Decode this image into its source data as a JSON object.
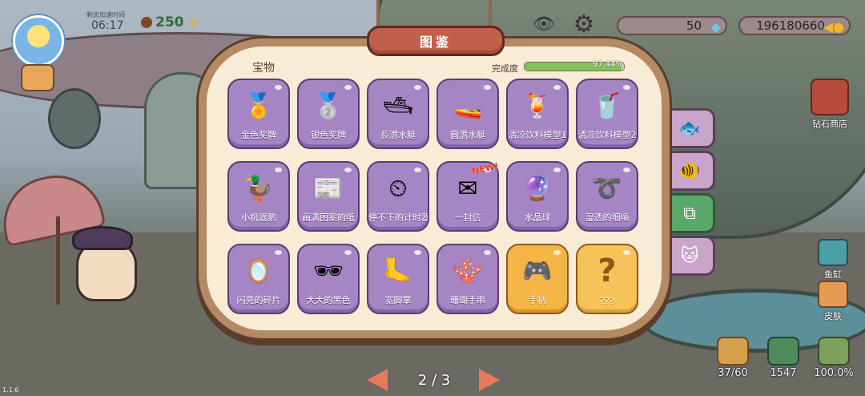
{
  "hud": {
    "time_label": "剩余加速时间",
    "time": "06:17",
    "coins": "250",
    "coins_plus": "+",
    "gems": "50",
    "fish_currency": "196180660",
    "version": "1.1.6"
  },
  "panel": {
    "title": "图鉴",
    "section": "宝物",
    "completion_label": "完成度",
    "completion_text": "97.44%",
    "completion_value": 97.44,
    "new_badge": "NEW!",
    "items": [
      {
        "name": "金色奖牌",
        "icon": "gold-medal-icon",
        "style": "purple",
        "glyph": "🏅"
      },
      {
        "name": "银色奖牌",
        "icon": "silver-medal-icon",
        "style": "purple",
        "glyph": "🥈"
      },
      {
        "name": "長潛水艇",
        "icon": "long-submarine-icon",
        "style": "purple",
        "glyph": "🛥"
      },
      {
        "name": "圓潛水艇",
        "icon": "round-submarine-icon",
        "style": "purple",
        "glyph": "🚤"
      },
      {
        "name": "清凉饮料模型1",
        "icon": "drink-model-1-icon",
        "style": "purple",
        "glyph": "🍹"
      },
      {
        "name": "清凉饮料模型2",
        "icon": "drink-model-2-icon",
        "style": "purple",
        "glyph": "🥤"
      },
      {
        "name": "小机器鹅",
        "icon": "robot-goose-icon",
        "style": "purple",
        "glyph": "🦆"
      },
      {
        "name": "画满图案的纸",
        "icon": "patterned-paper-icon",
        "style": "purple",
        "glyph": "📰"
      },
      {
        "name": "停不下的计时器",
        "icon": "timer-icon",
        "style": "purple",
        "glyph": "⏲"
      },
      {
        "name": "一封信",
        "icon": "letter-icon",
        "style": "purple",
        "glyph": "✉"
      },
      {
        "name": "水晶球",
        "icon": "crystal-ball-icon",
        "style": "purple",
        "glyph": "🔮"
      },
      {
        "name": "湿透的细绳",
        "icon": "wet-string-icon",
        "style": "purple",
        "glyph": "➰"
      },
      {
        "name": "闪亮的碎片",
        "icon": "mirror-shard-icon",
        "style": "purple",
        "glyph": "🪞"
      },
      {
        "name": "大大的黑色",
        "icon": "sunglasses-icon",
        "style": "purple",
        "glyph": "🕶"
      },
      {
        "name": "宽脚掌",
        "icon": "flippers-icon",
        "style": "purple",
        "glyph": "🦶"
      },
      {
        "name": "珊瑚手串",
        "icon": "coral-bracelet-icon",
        "style": "purple",
        "glyph": "🪸"
      },
      {
        "name": "手柄",
        "icon": "gamepad-icon",
        "style": "gold",
        "glyph": "🎮"
      },
      {
        "name": "???",
        "icon": "unknown-question-icon",
        "style": "unknown",
        "glyph": "?"
      }
    ]
  },
  "tabs": [
    {
      "icon": "fish-tab-icon",
      "glyph": "🐟",
      "active": false
    },
    {
      "icon": "fish-alt-tab-icon",
      "glyph": "🐠",
      "active": false
    },
    {
      "icon": "treasure-tab-icon",
      "glyph": "⧉",
      "active": true
    },
    {
      "icon": "cat-tab-icon",
      "glyph": "🐱",
      "active": false
    }
  ],
  "right": {
    "shop_label": "钻石商店",
    "tank_label": "鱼缸",
    "skin_label": "皮肤"
  },
  "bottom": {
    "stat1": "37/60",
    "stat2": "1547",
    "stat3": "100.0%"
  },
  "pager": {
    "text": "2 / 3",
    "current": 2,
    "total": 3
  },
  "colors": {
    "card_purple": "#a585c4",
    "card_gold": "#f4b547",
    "banner": "#c0604a",
    "progress": "#86c05b",
    "active_tab": "#5aa86a"
  }
}
